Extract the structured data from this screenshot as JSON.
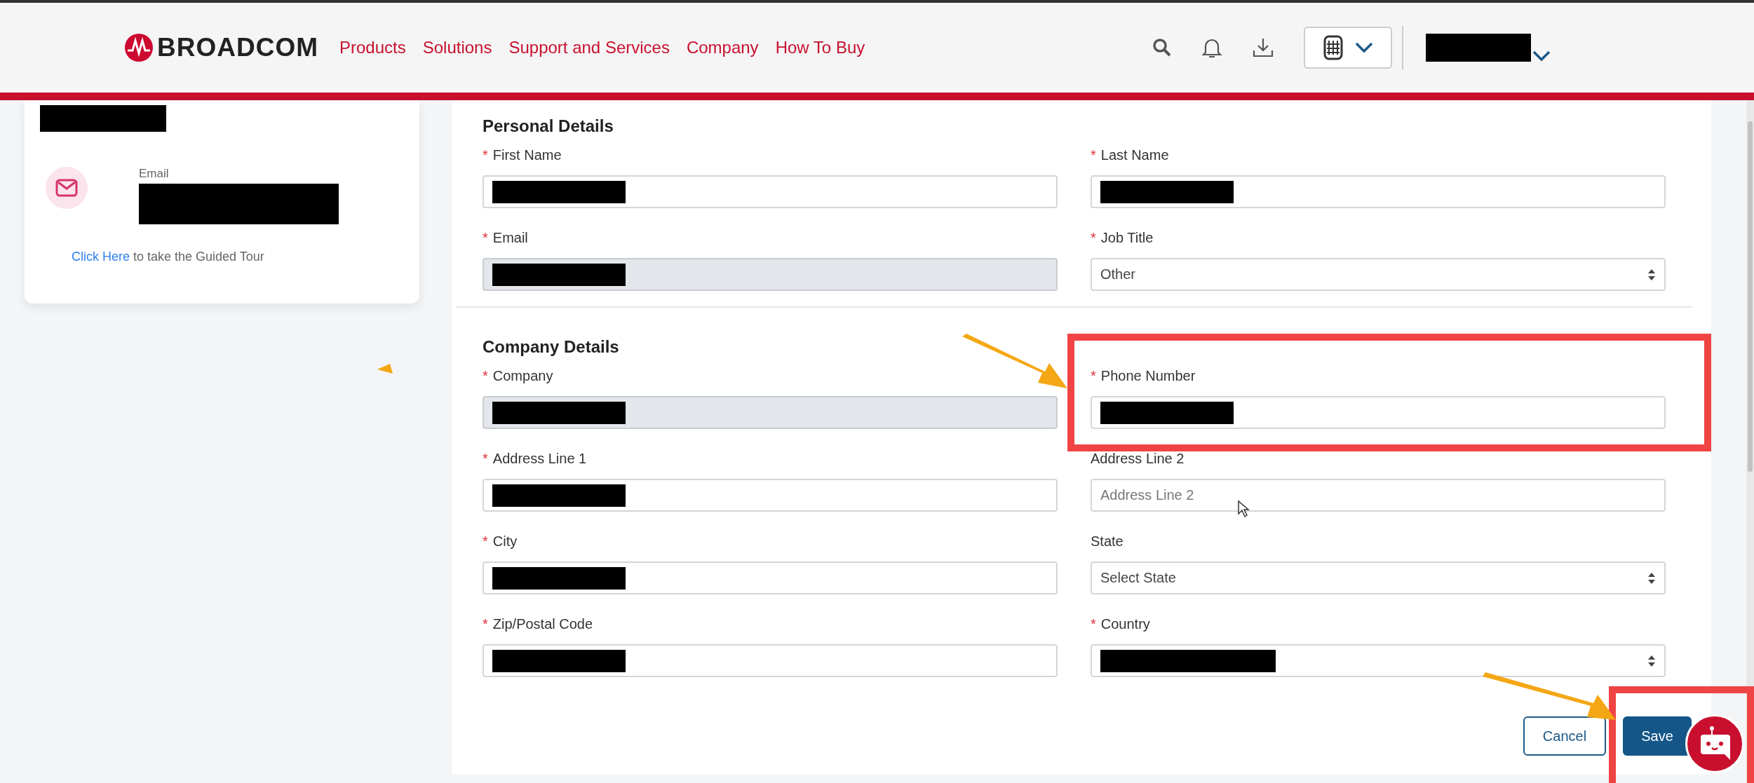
{
  "header": {
    "logo": "BROADCOM",
    "nav": [
      {
        "label": "Products"
      },
      {
        "label": "Solutions"
      },
      {
        "label": "Support and Services"
      },
      {
        "label": "Company"
      },
      {
        "label": "How To Buy"
      }
    ],
    "user_redacted": true
  },
  "profile": {
    "name_redacted": true,
    "email_label": "Email",
    "email_redacted": true,
    "tour_link": "Click Here",
    "tour_text": " to take the Guided Tour"
  },
  "required_mark": "*",
  "sections": [
    {
      "title": "Personal Details",
      "fields": [
        {
          "label": "First Name",
          "kind": "text",
          "required": true,
          "redacted": true,
          "disabled": false
        },
        {
          "label": "Last Name",
          "kind": "text",
          "required": true,
          "redacted": true,
          "disabled": false
        },
        {
          "label": "Email",
          "kind": "text",
          "required": true,
          "redacted": true,
          "disabled": true
        },
        {
          "label": "Job Title",
          "kind": "select",
          "required": true,
          "value": "Other",
          "disabled": false
        }
      ]
    },
    {
      "title": "Company Details",
      "fields": [
        {
          "label": "Company",
          "kind": "text",
          "required": true,
          "redacted": true,
          "disabled": true
        },
        {
          "label": "Phone Number",
          "kind": "text",
          "required": true,
          "redacted": true,
          "disabled": false
        },
        {
          "label": "Address Line 1",
          "kind": "text",
          "required": true,
          "redacted": true,
          "disabled": false
        },
        {
          "label": "Address Line 2",
          "kind": "text",
          "required": false,
          "placeholder": "Address Line 2",
          "disabled": false
        },
        {
          "label": "City",
          "kind": "text",
          "required": true,
          "redacted": true,
          "disabled": false
        },
        {
          "label": "State",
          "kind": "select",
          "required": false,
          "value": "Select State",
          "disabled": false
        },
        {
          "label": "Zip/Postal Code",
          "kind": "text",
          "required": true,
          "redacted": true,
          "disabled": false
        },
        {
          "label": "Country",
          "kind": "select",
          "required": true,
          "redacted": true,
          "disabled": false
        }
      ]
    }
  ],
  "buttons": [
    {
      "label": "Cancel",
      "kind": "secondary"
    },
    {
      "label": "Save",
      "kind": "primary"
    }
  ]
}
